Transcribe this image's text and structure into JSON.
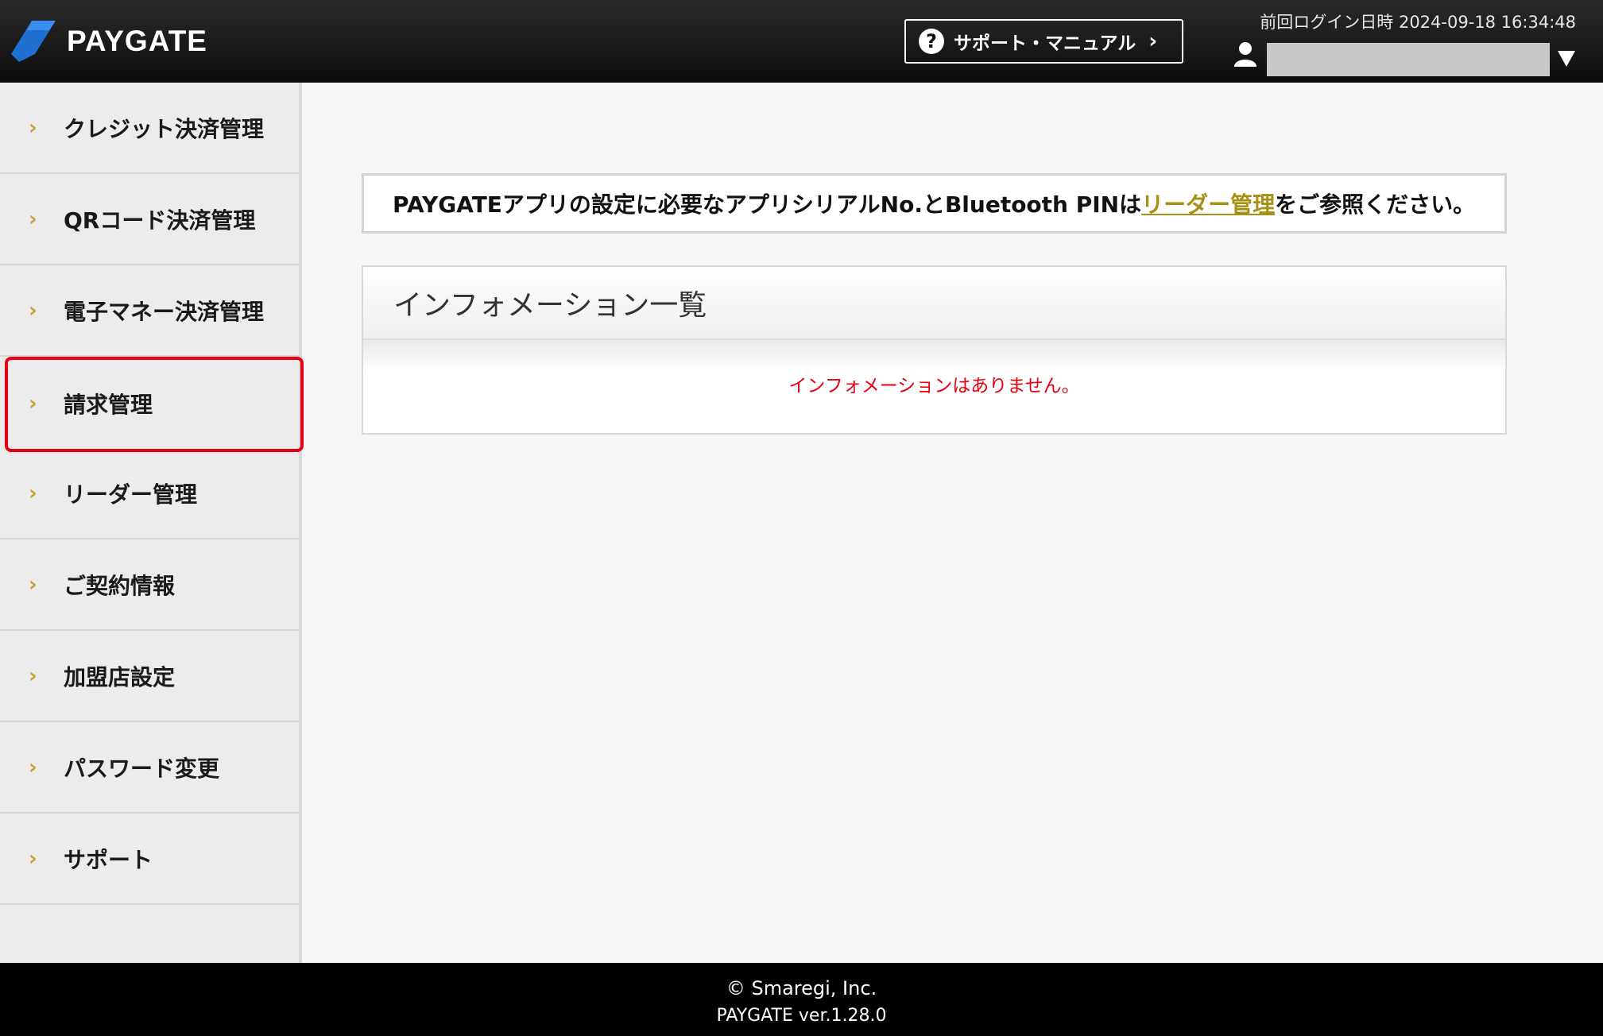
{
  "header": {
    "logo_text": "PAYGATE",
    "support_button": "サポート・マニュアル",
    "last_login": "前回ログイン日時 2024-09-18 16:34:48"
  },
  "sidebar": {
    "items": [
      {
        "label": "クレジット決済管理"
      },
      {
        "label": "QRコード決済管理"
      },
      {
        "label": "電子マネー決済管理"
      },
      {
        "label": "請求管理"
      },
      {
        "label": "リーダー管理"
      },
      {
        "label": "ご契約情報"
      },
      {
        "label": "加盟店設定"
      },
      {
        "label": "パスワード変更"
      },
      {
        "label": "サポート"
      }
    ]
  },
  "notice": {
    "before": "PAYGATEアプリの設定に必要なアプリシリアルNo.とBluetooth PINは",
    "link": "リーダー管理",
    "after": "をご参照ください。"
  },
  "info": {
    "title": "インフォメーション一覧",
    "empty_message": "インフォメーションはありません。"
  },
  "footer": {
    "copyright": "© Smaregi, Inc.",
    "version": "PAYGATE ver.1.28.0"
  },
  "colors": {
    "accent_gold": "#a79016",
    "chevron_gold": "#c7a337",
    "highlight_red": "#e60012"
  }
}
